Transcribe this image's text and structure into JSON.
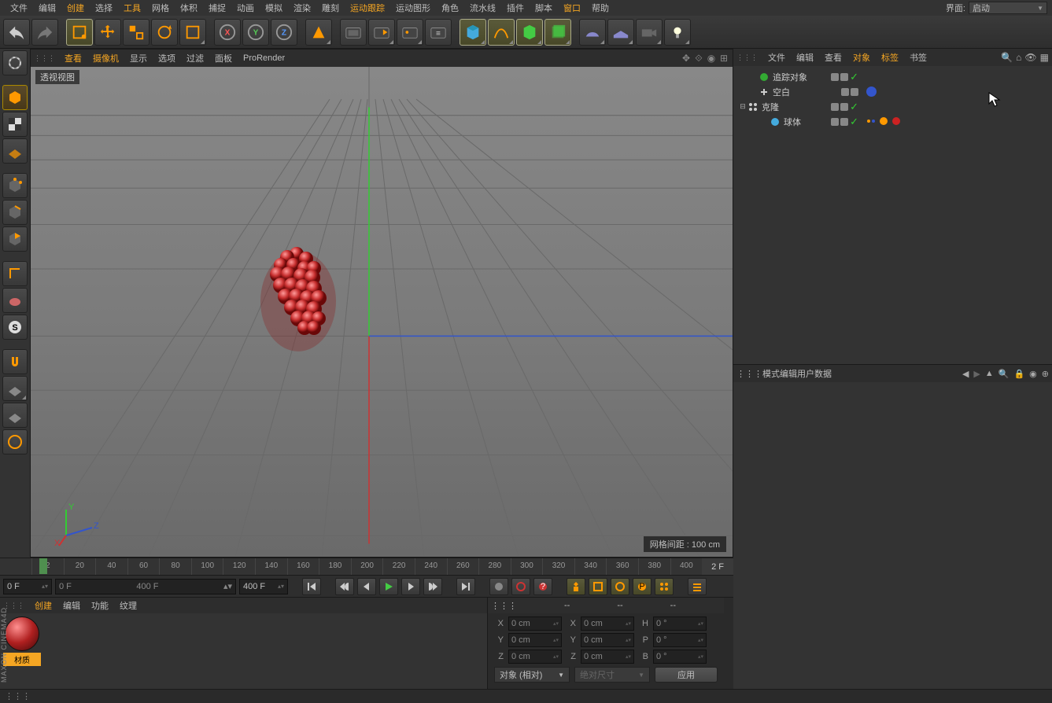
{
  "interface": {
    "label": "界面:",
    "value": "启动"
  },
  "menu": {
    "items": [
      "文件",
      "编辑",
      "创建",
      "选择",
      "工具",
      "网格",
      "体积",
      "捕捉",
      "动画",
      "模拟",
      "渲染",
      "雕刻",
      "运动跟踪",
      "运动图形",
      "角色",
      "流水线",
      "插件",
      "脚本",
      "窗口",
      "帮助"
    ],
    "hl": [
      2,
      4,
      12,
      18
    ]
  },
  "vp_menu": {
    "items": [
      "查看",
      "摄像机",
      "显示",
      "选项",
      "过滤",
      "面板",
      "ProRender"
    ],
    "hl": [
      0,
      1
    ]
  },
  "vp_label": "透视视图",
  "grid_distance": "网格间距 : 100 cm",
  "axes": {
    "x": "X",
    "y": "Y",
    "z": "Z"
  },
  "timeline": {
    "ticks": [
      "2",
      "20",
      "40",
      "60",
      "80",
      "100",
      "120",
      "140",
      "160",
      "180",
      "200",
      "220",
      "240",
      "260",
      "280",
      "300",
      "320",
      "340",
      "360",
      "380",
      "400"
    ],
    "current": "2 F",
    "start": "0 F",
    "end": "400 F",
    "s0": "0 F",
    "s1": "400 F"
  },
  "mat_menu": {
    "items": [
      "创建",
      "编辑",
      "功能",
      "纹理"
    ],
    "hl": [
      0
    ]
  },
  "material": {
    "name": "材质"
  },
  "coord_header": {
    "a": "--",
    "b": "--",
    "c": "--"
  },
  "coord": {
    "rows": [
      {
        "l1": "X",
        "v1": "0 cm",
        "l2": "X",
        "v2": "0 cm",
        "l3": "H",
        "v3": "0 °"
      },
      {
        "l1": "Y",
        "v1": "0 cm",
        "l2": "Y",
        "v2": "0 cm",
        "l3": "P",
        "v3": "0 °"
      },
      {
        "l1": "Z",
        "v1": "0 cm",
        "l2": "Z",
        "v2": "0 cm",
        "l3": "B",
        "v3": "0 °"
      }
    ],
    "sel1": "对象 (相对)",
    "sel2": "绝对尺寸",
    "apply": "应用"
  },
  "obj_menu": {
    "items": [
      "文件",
      "编辑",
      "查看",
      "对象",
      "标签",
      "书签"
    ],
    "hl": [
      3,
      4
    ]
  },
  "tree": [
    {
      "indent": 1,
      "name": "追踪对象",
      "icon": "tracker",
      "tags": []
    },
    {
      "indent": 1,
      "name": "空白",
      "icon": "null",
      "tags": [
        "dot-blue"
      ]
    },
    {
      "indent": 0,
      "twist": "⊟",
      "name": "克隆",
      "icon": "cloner",
      "tags": []
    },
    {
      "indent": 2,
      "name": "球体",
      "icon": "sphere",
      "tags": [
        "dyn",
        "mograph",
        "mat"
      ]
    }
  ],
  "attr_menu": {
    "items": [
      "模式",
      "编辑",
      "用户数据"
    ]
  }
}
